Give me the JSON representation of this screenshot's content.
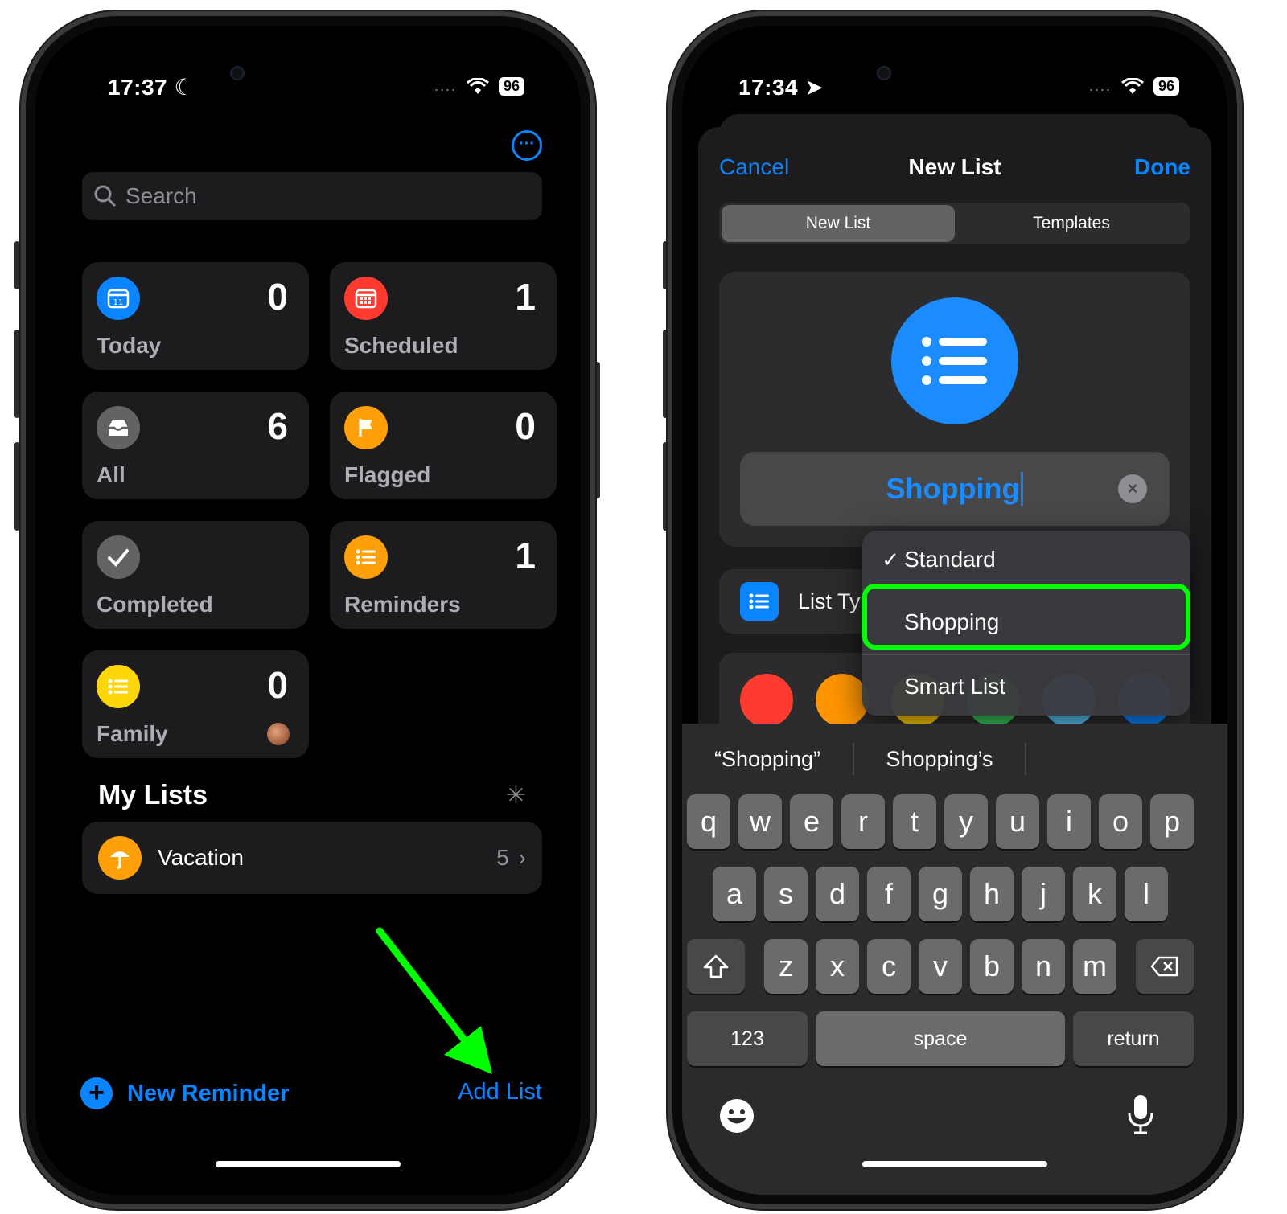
{
  "left": {
    "status": {
      "time": "17:37",
      "battery": "96"
    },
    "search": {
      "placeholder": "Search"
    },
    "tiles": [
      {
        "label": "Today",
        "count": "0",
        "icon": "calendar-today-icon",
        "color": "#0a84ff"
      },
      {
        "label": "Scheduled",
        "count": "1",
        "icon": "calendar-scheduled-icon",
        "color": "#ff3b30"
      },
      {
        "label": "All",
        "count": "6",
        "icon": "tray-icon",
        "color": "#636366"
      },
      {
        "label": "Flagged",
        "count": "0",
        "icon": "flag-icon",
        "color": "#ff9f0a"
      },
      {
        "label": "Completed",
        "count": "",
        "icon": "checkmark-icon",
        "color": "#636366"
      },
      {
        "label": "Reminders",
        "count": "1",
        "icon": "list-icon",
        "color": "#ff9f0a"
      },
      {
        "label": "Family",
        "count": "0",
        "icon": "list-icon",
        "color": "#ffd60a"
      }
    ],
    "my_lists": {
      "title": "My Lists",
      "items": [
        {
          "name": "Vacation",
          "count": "5",
          "icon": "umbrella-icon",
          "color": "#ff9f0a"
        }
      ]
    },
    "bottom": {
      "new_reminder": "New Reminder",
      "add_list": "Add List"
    }
  },
  "right": {
    "status": {
      "time": "17:34",
      "battery": "96"
    },
    "nav": {
      "cancel": "Cancel",
      "title": "New List",
      "done": "Done"
    },
    "segments": [
      "New List",
      "Templates"
    ],
    "list_name": "Shopping",
    "type_row_label": "List Ty",
    "menu": {
      "items": [
        {
          "label": "Standard",
          "check": "✓"
        },
        {
          "label": "Shopping",
          "check": ""
        },
        {
          "label": "Smart List",
          "check": ""
        }
      ]
    },
    "swatches": [
      "#ff3b30",
      "#ff9500",
      "#ffcc00",
      "#34c759",
      "#5ac8fa",
      "#0a84ff"
    ],
    "keyboard": {
      "suggestions": [
        "“Shopping”",
        "Shopping’s",
        ""
      ],
      "row1": [
        "q",
        "w",
        "e",
        "r",
        "t",
        "y",
        "u",
        "i",
        "o",
        "p"
      ],
      "row2": [
        "a",
        "s",
        "d",
        "f",
        "g",
        "h",
        "j",
        "k",
        "l"
      ],
      "row3": [
        "z",
        "x",
        "c",
        "v",
        "b",
        "n",
        "m"
      ],
      "numbers": "123",
      "space": "space",
      "return": "return"
    }
  },
  "colors": {
    "accent": "#0a84ff",
    "highlight": "#00ff00"
  }
}
